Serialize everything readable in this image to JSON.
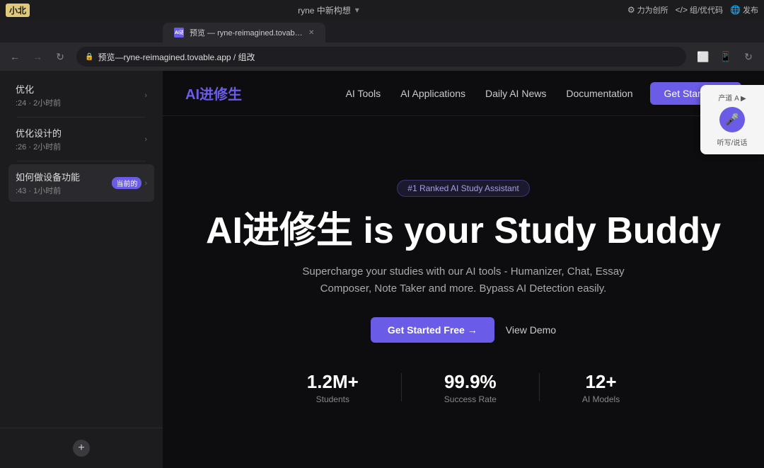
{
  "os_bar": {
    "logo": "小北",
    "title": "ryne 中新构想",
    "chevron": "▾",
    "right_actions": [
      {
        "id": "settings",
        "label": "⚙",
        "text": "力为创所"
      },
      {
        "id": "code",
        "label": "</>",
        "text": "组/优代码"
      },
      {
        "id": "publish",
        "label": "🌐",
        "text": "发布"
      }
    ]
  },
  "browser": {
    "tab": {
      "favicon_text": "A",
      "title": "预览 — ryne-reimagined.tovable.app / 组改",
      "chevron": "▾"
    },
    "url": "预览 — ryne-reimagined.tovable.app / 组改 ▾",
    "url_short": "预览—ryne-reimagined.tovable.app / 组改"
  },
  "sidebar": {
    "items": [
      {
        "id": "notifications",
        "title": "优化",
        "subtitle": ":24 · 2小时前",
        "has_chevron": true
      },
      {
        "id": "item2",
        "title": "优化设计的",
        "subtitle": ":26 · 2小时前",
        "has_chevron": true
      },
      {
        "id": "item3",
        "title": "如何做设备功能",
        "subtitle": ":43 · 1小时前",
        "has_chevron": true,
        "badge": "当前的"
      }
    ],
    "add_button": "+"
  },
  "website": {
    "nav": {
      "logo": "AI进修生",
      "links": [
        {
          "id": "tools",
          "label": "AI Tools"
        },
        {
          "id": "applications",
          "label": "AI Applications"
        },
        {
          "id": "news",
          "label": "Daily AI News"
        },
        {
          "id": "docs",
          "label": "Documentation"
        }
      ],
      "cta": "Get Started →"
    },
    "hero": {
      "badge": "#1 Ranked AI Study Assistant",
      "title": "AI进修生 is your Study Buddy",
      "description": "Supercharge your studies with our AI tools - Humanizer, Chat, Essay Composer, Note Taker and more. Bypass AI Detection easily.",
      "primary_btn": "Get Started Free →",
      "secondary_btn": "View Demo",
      "stats": [
        {
          "value": "1.2M+",
          "label": "Students"
        },
        {
          "value": "99.9%",
          "label": "Success Rate"
        },
        {
          "value": "12+",
          "label": "AI Models"
        }
      ]
    }
  },
  "floating_panel": {
    "title": "产道 A ▶",
    "mic_icon": "🎤",
    "actions": "听写/说话"
  }
}
